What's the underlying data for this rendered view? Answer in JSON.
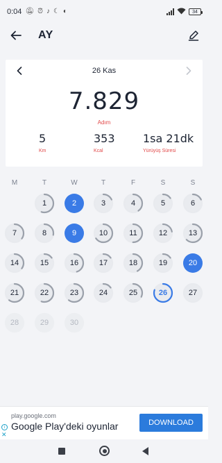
{
  "status_bar": {
    "time": "0:04",
    "battery": "34"
  },
  "app_bar": {
    "title": "AY"
  },
  "summary": {
    "date": "26 Kas",
    "steps": "7.829",
    "steps_label": "Adım",
    "distance_value": "5",
    "distance_label": "Km",
    "calories_value": "353",
    "calories_label": "Kcal",
    "duration_value": "1sa 21dk",
    "duration_label": "Yürüyüş Süresi"
  },
  "weekdays": [
    "M",
    "T",
    "W",
    "T",
    "F",
    "S",
    "S"
  ],
  "calendar": {
    "start_col": 1,
    "days": [
      {
        "n": "1",
        "p": 0.55,
        "state": "normal"
      },
      {
        "n": "2",
        "p": 1.0,
        "state": "selected"
      },
      {
        "n": "3",
        "p": 0.18,
        "state": "normal"
      },
      {
        "n": "4",
        "p": 0.4,
        "state": "normal"
      },
      {
        "n": "5",
        "p": 0.15,
        "state": "normal"
      },
      {
        "n": "6",
        "p": 0.18,
        "state": "normal"
      },
      {
        "n": "7",
        "p": 0.35,
        "state": "normal"
      },
      {
        "n": "8",
        "p": 0.28,
        "state": "normal"
      },
      {
        "n": "9",
        "p": 1.0,
        "state": "selected"
      },
      {
        "n": "10",
        "p": 0.65,
        "state": "normal"
      },
      {
        "n": "11",
        "p": 0.5,
        "state": "normal"
      },
      {
        "n": "12",
        "p": 0.22,
        "state": "normal"
      },
      {
        "n": "13",
        "p": 0.62,
        "state": "normal"
      },
      {
        "n": "14",
        "p": 0.35,
        "state": "normal"
      },
      {
        "n": "15",
        "p": 0.15,
        "state": "normal"
      },
      {
        "n": "16",
        "p": 0.45,
        "state": "normal"
      },
      {
        "n": "17",
        "p": 0.15,
        "state": "normal"
      },
      {
        "n": "18",
        "p": 0.42,
        "state": "normal"
      },
      {
        "n": "19",
        "p": 0.15,
        "state": "normal"
      },
      {
        "n": "20",
        "p": 1.0,
        "state": "selected"
      },
      {
        "n": "21",
        "p": 0.6,
        "state": "normal"
      },
      {
        "n": "22",
        "p": 0.55,
        "state": "normal"
      },
      {
        "n": "23",
        "p": 0.6,
        "state": "normal"
      },
      {
        "n": "24",
        "p": 0.15,
        "state": "normal"
      },
      {
        "n": "25",
        "p": 0.32,
        "state": "normal"
      },
      {
        "n": "26",
        "p": 0.8,
        "state": "today"
      },
      {
        "n": "27",
        "p": 0.0,
        "state": "normal"
      },
      {
        "n": "28",
        "p": 0.0,
        "state": "future"
      },
      {
        "n": "29",
        "p": 0.0,
        "state": "future"
      },
      {
        "n": "30",
        "p": 0.0,
        "state": "future"
      }
    ]
  },
  "ad": {
    "url": "play.google.com",
    "title": "Google Play'deki oyunlar",
    "button": "DOWNLOAD"
  },
  "icons": {
    "back": "arrow-left-icon",
    "edit": "pencil-icon",
    "prev": "chevron-left-icon",
    "next": "chevron-right-icon"
  },
  "colors": {
    "accent": "#3a7be6",
    "label_red": "#e14848",
    "ring_track": "#e8eaee",
    "ring_progress": "#9aa0aa"
  }
}
